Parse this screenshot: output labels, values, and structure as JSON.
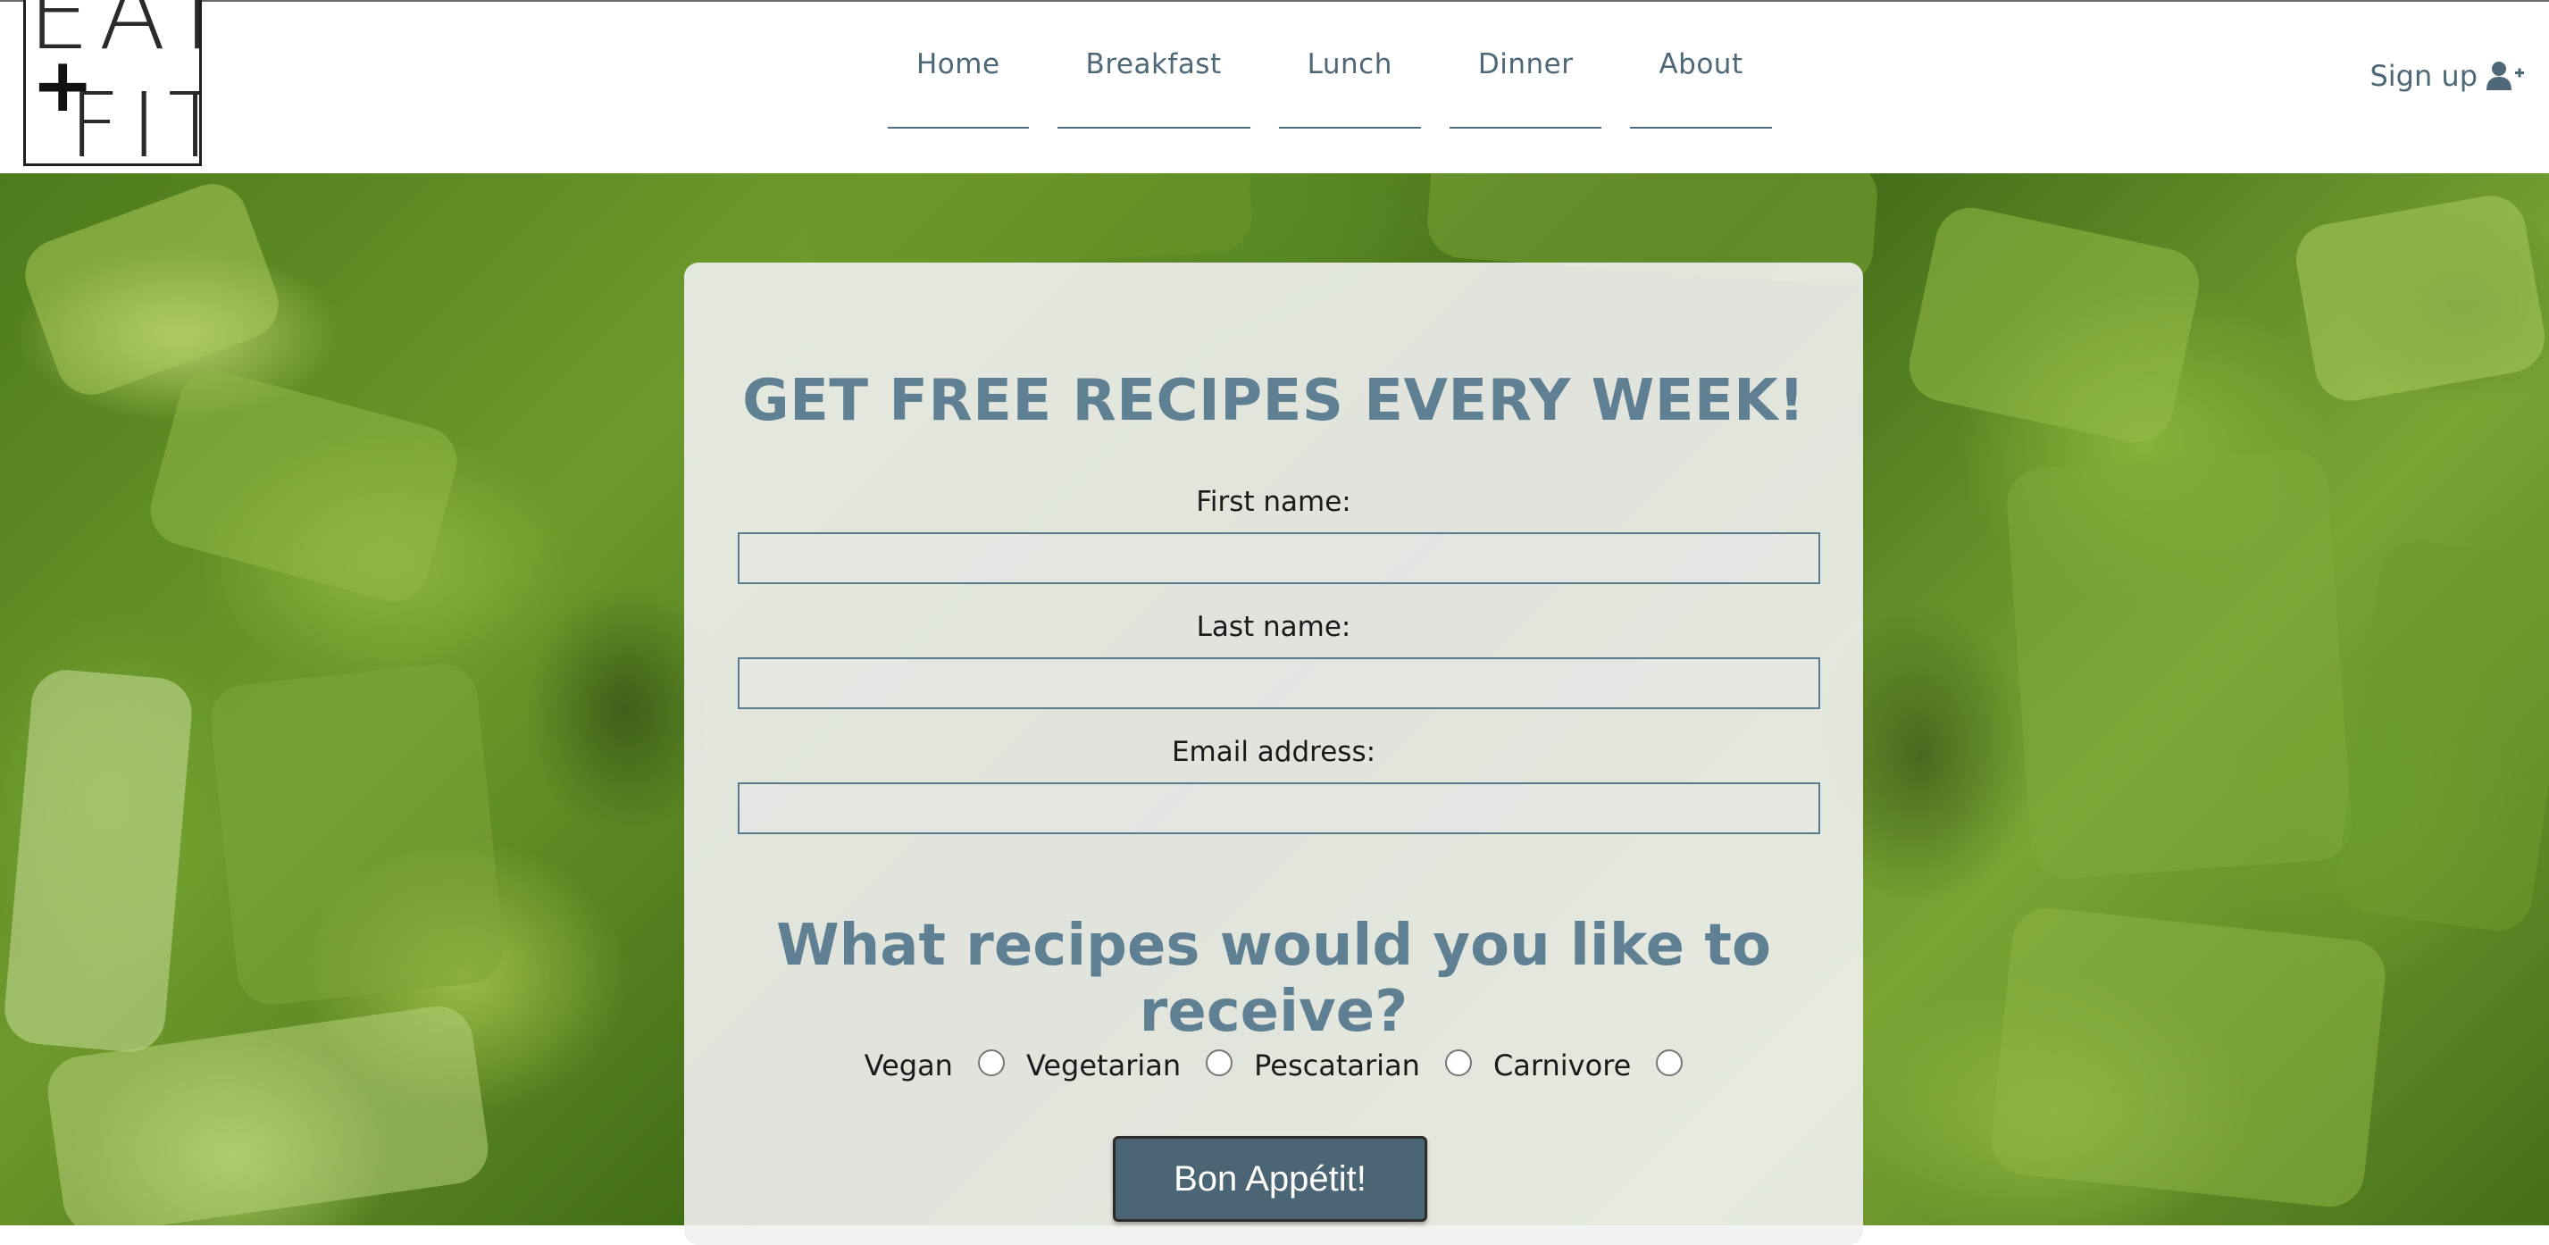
{
  "logo": {
    "line1": "EAT",
    "plus": "+",
    "line2": "FIT"
  },
  "nav": {
    "items": [
      {
        "label": "Home"
      },
      {
        "label": "Breakfast"
      },
      {
        "label": "Lunch"
      },
      {
        "label": "Dinner"
      },
      {
        "label": "About"
      }
    ]
  },
  "header": {
    "signup_label": "Sign up",
    "signup_icon": "user-plus-icon"
  },
  "form": {
    "title": "GET FREE RECIPES EVERY WEEK!",
    "first_name_label": "First name:",
    "first_name_value": "",
    "last_name_label": "Last name:",
    "last_name_value": "",
    "email_label": "Email address:",
    "email_value": "",
    "recipes_question": "What recipes would you like to receive?",
    "options": [
      {
        "label": "Vegan",
        "selected": false
      },
      {
        "label": "Vegetarian",
        "selected": false
      },
      {
        "label": "Pescatarian",
        "selected": false
      },
      {
        "label": "Carnivore",
        "selected": false
      }
    ],
    "submit_label": "Bon Appétit!"
  },
  "colors": {
    "accent": "#5f7f92",
    "nav_text": "#4e6878",
    "button_bg": "#4b6575",
    "background_theme": "green-onion-photo"
  }
}
